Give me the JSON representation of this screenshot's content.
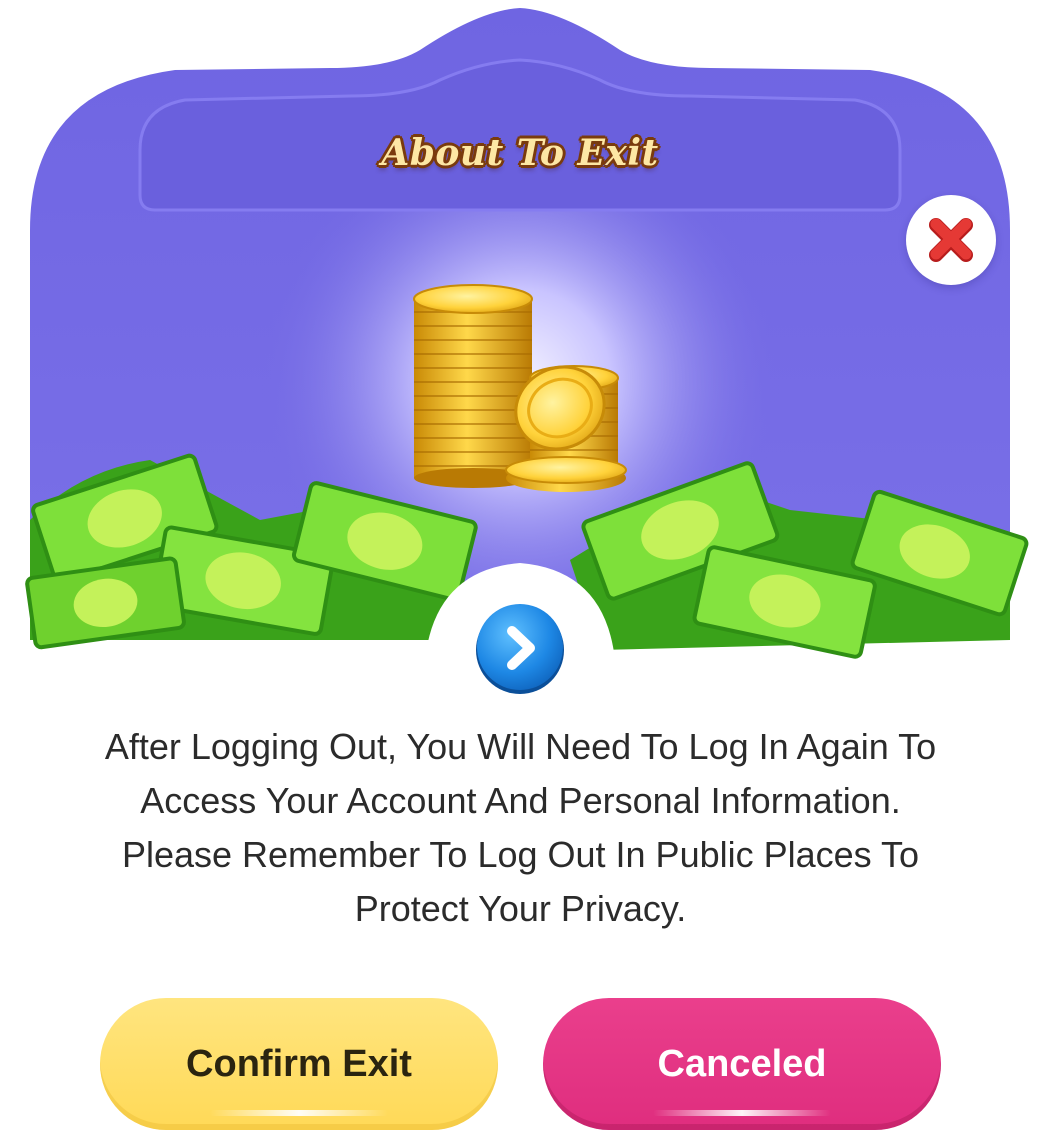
{
  "dialog": {
    "title": "About To Exit",
    "message": "After Logging Out, You Will Need To Log In Again To Access Your Account And Personal Information. Please Remember To Log Out In Public Places To Protect Your Privacy.",
    "confirm_label": "Confirm Exit",
    "cancel_label": "Canceled"
  },
  "icons": {
    "close": "close-icon",
    "arrow": "chevron-right-icon",
    "coins": "gold-coins-illustration",
    "money": "cash-bills-illustration"
  },
  "colors": {
    "header_purple": "#736ae3",
    "confirm_yellow": "#ffe06b",
    "cancel_pink": "#e3337f",
    "close_red": "#e0302d",
    "arrow_blue": "#1e88e5"
  }
}
